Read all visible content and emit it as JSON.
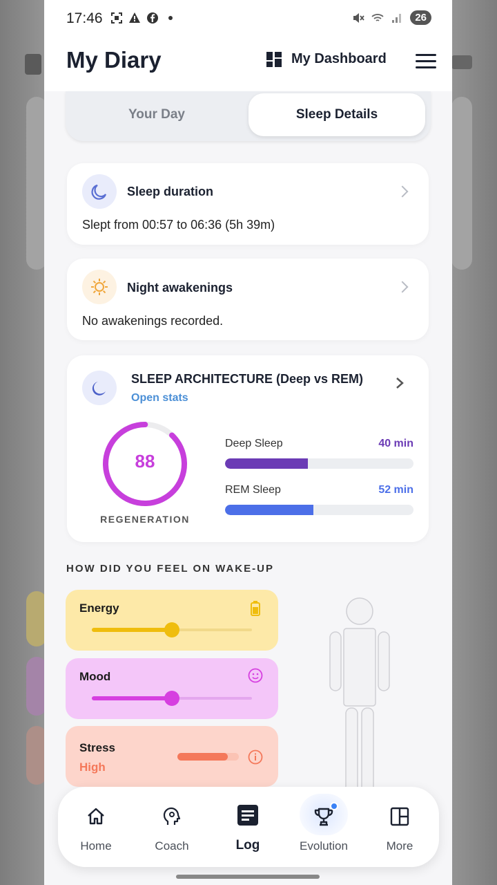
{
  "status_bar": {
    "time": "17:46",
    "battery": "26"
  },
  "header": {
    "title": "My Diary",
    "dashboard_label": "My Dashboard"
  },
  "tabs": [
    {
      "label": "Your Day",
      "active": false
    },
    {
      "label": "Sleep Details",
      "active": true
    }
  ],
  "sleep_duration": {
    "title": "Sleep duration",
    "text": "Slept from 00:57 to 06:36 (5h 39m)"
  },
  "night_awakenings": {
    "title": "Night awakenings",
    "text": "No awakenings recorded."
  },
  "sleep_architecture": {
    "title": "SLEEP ARCHITECTURE (Deep vs REM)",
    "link": "Open stats",
    "score": "88",
    "score_fraction": 0.88,
    "score_label": "REGENERATION",
    "score_color": "#c73fdc",
    "deep": {
      "label": "Deep Sleep",
      "value": "40 min",
      "fill_fraction": 0.44,
      "color": "#6b3bb5"
    },
    "rem": {
      "label": "REM Sleep",
      "value": "52 min",
      "fill_fraction": 0.47,
      "color": "#4c6fe8"
    }
  },
  "wake_up": {
    "heading": "HOW DID YOU FEEL ON WAKE-UP",
    "energy": {
      "label": "Energy",
      "level": 0.5,
      "bg": "#fde9a8",
      "color": "#efbd0d",
      "icon": "battery-icon"
    },
    "mood": {
      "label": "Mood",
      "level": 0.5,
      "bg": "#f4c6f9",
      "color": "#d63fe0",
      "icon": "smiley-icon"
    },
    "stress": {
      "label": "Stress",
      "value": "High",
      "level": 0.82,
      "bg": "#fdd5cb",
      "color": "#f4785a",
      "icon": "info-icon"
    }
  },
  "nav": [
    {
      "label": "Home",
      "icon": "home-icon"
    },
    {
      "label": "Coach",
      "icon": "coach-head-icon"
    },
    {
      "label": "Log",
      "icon": "log-icon",
      "active": true
    },
    {
      "label": "Evolution",
      "icon": "trophy-icon",
      "badge": true
    },
    {
      "label": "More",
      "icon": "more-grid-icon"
    }
  ]
}
